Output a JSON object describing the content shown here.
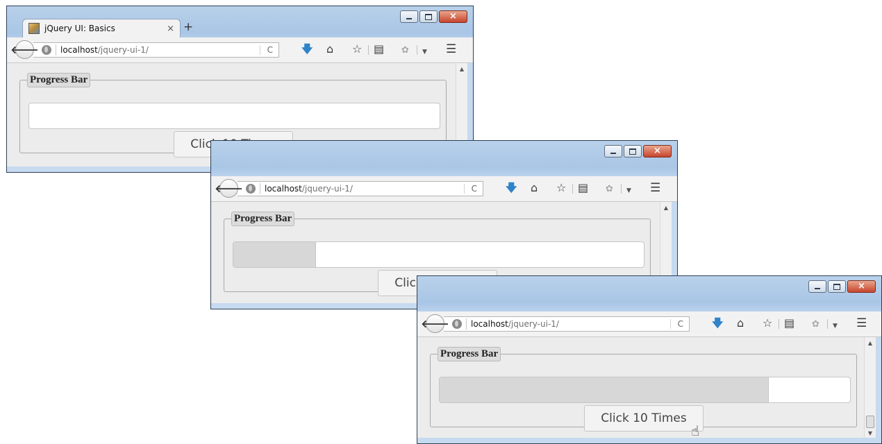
{
  "browser": {
    "tab_title": "jQuery UI: Basics",
    "tab_close": "×",
    "new_tab": "+",
    "url_host": "localhost",
    "url_path": "/jquery-ui-1/",
    "reload": "C",
    "window_controls": {
      "close": "×"
    },
    "icons": [
      "back-arrow-icon",
      "globe-icon",
      "reload-icon",
      "download-icon",
      "home-icon",
      "bookmark-star-icon",
      "reading-list-icon",
      "extension-icon",
      "dropdown-arrow-icon",
      "hamburger-menu-icon"
    ]
  },
  "page": {
    "legend": "Progress Bar",
    "button_label": "Click 10 Times"
  },
  "windows": [
    {
      "progress_fraction": 0.0,
      "cursor_visible": false
    },
    {
      "progress_fraction": 0.2,
      "cursor_visible": true
    },
    {
      "progress_fraction": 0.8,
      "cursor_visible": true
    }
  ],
  "colors": {
    "titlebar": "#a9c6e6",
    "close_button": "#c7452c",
    "progress_fill": "#d7d7d7",
    "content_bg": "#ececec"
  }
}
